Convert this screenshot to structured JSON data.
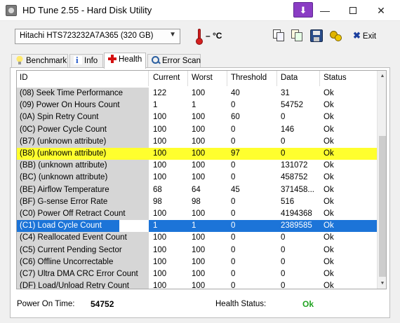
{
  "window": {
    "title": "HD Tune 2.55 - Hard Disk Utility",
    "purple_button_glyph": "⬇",
    "minimize_glyph": "—",
    "close_glyph": "✕"
  },
  "toolbar": {
    "drive": "Hitachi HTS723232A7A365 (320 GB)",
    "temperature": "– °C",
    "exit_label": "Exit",
    "exit_glyph": "✖"
  },
  "tabs": [
    {
      "label": "Benchmark",
      "icon": "lightbulb-icon"
    },
    {
      "label": "Info",
      "icon": "info-icon"
    },
    {
      "label": "Health",
      "icon": "red-cross-icon",
      "active": true
    },
    {
      "label": "Error Scan",
      "icon": "magnifier-icon"
    }
  ],
  "grid": {
    "columns": [
      "ID",
      "Current",
      "Worst",
      "Threshold",
      "Data",
      "Status"
    ],
    "rows": [
      [
        "(08) Seek Time Performance",
        "122",
        "100",
        "40",
        "31",
        "Ok"
      ],
      [
        "(09) Power On Hours Count",
        "1",
        "1",
        "0",
        "54752",
        "Ok"
      ],
      [
        "(0A) Spin Retry Count",
        "100",
        "100",
        "60",
        "0",
        "Ok"
      ],
      [
        "(0C) Power Cycle Count",
        "100",
        "100",
        "0",
        "146",
        "Ok"
      ],
      [
        "(B7) (unknown attribute)",
        "100",
        "100",
        "0",
        "0",
        "Ok"
      ],
      [
        "(B8) (unknown attribute)",
        "100",
        "100",
        "97",
        "0",
        "Ok"
      ],
      [
        "(BB) (unknown attribute)",
        "100",
        "100",
        "0",
        "131072",
        "Ok"
      ],
      [
        "(BC) (unknown attribute)",
        "100",
        "100",
        "0",
        "458752",
        "Ok"
      ],
      [
        "(BE) Airflow Temperature",
        "68",
        "64",
        "45",
        "371458...",
        "Ok"
      ],
      [
        "(BF) G-sense Error Rate",
        "98",
        "98",
        "0",
        "516",
        "Ok"
      ],
      [
        "(C0) Power Off Retract Count",
        "100",
        "100",
        "0",
        "4194368",
        "Ok"
      ],
      [
        "(C1) Load Cycle Count",
        "1",
        "1",
        "0",
        "2389585",
        "Ok"
      ],
      [
        "(C4) Reallocated Event Count",
        "100",
        "100",
        "0",
        "0",
        "Ok"
      ],
      [
        "(C5) Current Pending Sector",
        "100",
        "100",
        "0",
        "0",
        "Ok"
      ],
      [
        "(C6) Offline Uncorrectable",
        "100",
        "100",
        "0",
        "0",
        "Ok"
      ],
      [
        "(C7) Ultra DMA CRC Error Count",
        "100",
        "100",
        "0",
        "0",
        "Ok"
      ],
      [
        "(DF) Load/Unload Retry Count",
        "100",
        "100",
        "0",
        "0",
        "Ok"
      ]
    ],
    "highlighted_row": 5,
    "selected_row": 11
  },
  "footer": {
    "power_on_time_label": "Power On Time:",
    "power_on_time_value": "54752",
    "health_status_label": "Health Status:",
    "health_status_value": "Ok"
  },
  "colors": {
    "highlight": "#ffff2e",
    "selection": "#1c74d8",
    "ok_green": "#21a321",
    "temperature_red": "#d42020"
  }
}
